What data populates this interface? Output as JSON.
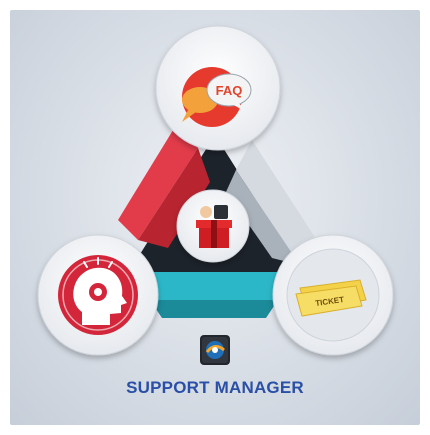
{
  "title": "SUPPORT MANAGER",
  "faq_bubble_text": "FAQ",
  "ticket_text": "TICKET",
  "colors": {
    "title": "#2a4fa6",
    "red_face": "#e23b4a",
    "cyan_face": "#2bb7c8",
    "dark_face": "#1d232b",
    "gray_face": "#cfd5dc",
    "faq_orange": "#f08a1c",
    "ticket_yellow": "#f3d24a"
  },
  "icons": {
    "top": "faq-chat-icon",
    "left": "head-gear-icon",
    "right": "ticket-icon",
    "center": "support-gift-icon",
    "logo": "support-manager-logo-icon"
  }
}
